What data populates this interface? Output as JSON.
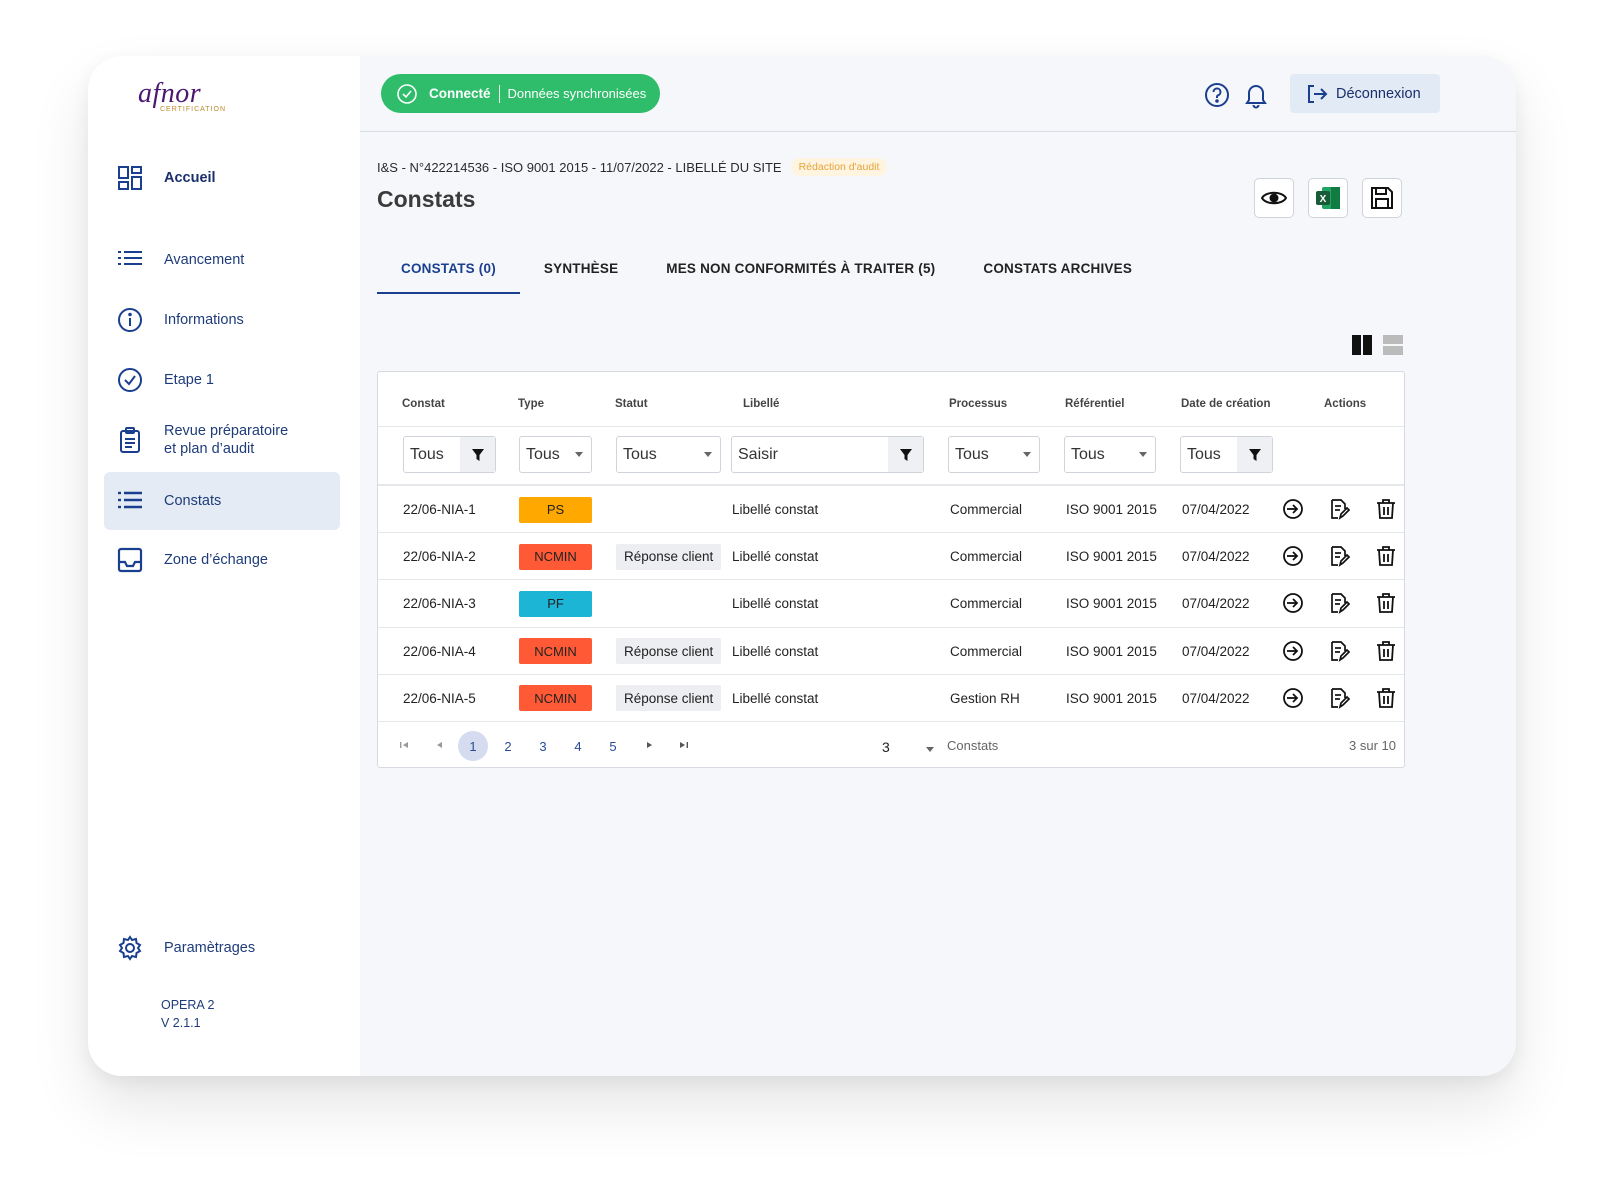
{
  "logo": {
    "word": "afnor",
    "sub": "CERTIFICATION"
  },
  "sidebar": {
    "items": [
      {
        "label": "Accueil",
        "icon": "dashboard-icon"
      },
      {
        "label": "Avancement",
        "icon": "list-icon"
      },
      {
        "label": "Informations",
        "icon": "info-icon"
      },
      {
        "label": "Etape 1",
        "icon": "check-circle-icon"
      },
      {
        "label": "Revue préparatoire\net plan d’audit",
        "icon": "clipboard-icon"
      },
      {
        "label": "Constats",
        "icon": "list-icon"
      },
      {
        "label": "Zone d’échange",
        "icon": "inbox-icon"
      },
      {
        "label": "Paramètrages",
        "icon": "gear-icon"
      }
    ],
    "version_line1": "OPERA 2",
    "version_line2": "V 2.1.1"
  },
  "topbar": {
    "status_connected": "Connecté",
    "status_synced": "Données synchronisées",
    "logout_label": "Déconnexion"
  },
  "header": {
    "breadcrumb": "I&S -  N°422214536 - ISO 9001 2015 - 11/07/2022 - LIBELLÉ DU SITE",
    "badge": "Rédaction d'audit",
    "title": "Constats"
  },
  "tabs": [
    "CONSTATS (0)",
    "SYNTHÈSE",
    "MES NON CONFORMITÉS À TRAITER (5)",
    "CONSTATS ARCHIVES"
  ],
  "table": {
    "columns": [
      "Constat",
      "Type",
      "Statut",
      "Libellé",
      "Processus",
      "Référentiel",
      "Date de création",
      "Actions"
    ],
    "filters": {
      "constat": "Tous",
      "type": "Tous",
      "statut": "Tous",
      "libelle_placeholder": "Saisir",
      "processus": "Tous",
      "referentiel": "Tous",
      "date": "Tous"
    },
    "rows": [
      {
        "constat": "22/06-NIA-1",
        "type": "PS",
        "type_color": "#ffa800",
        "statut": "",
        "libelle": "Libellé constat",
        "processus": "Commercial",
        "referentiel": "ISO 9001 2015",
        "date": "07/04/2022"
      },
      {
        "constat": "22/06-NIA-2",
        "type": "NCMIN",
        "type_color": "#ff5a35",
        "statut": "Réponse client",
        "libelle": "Libellé constat",
        "processus": "Commercial",
        "referentiel": "ISO 9001 2015",
        "date": "07/04/2022"
      },
      {
        "constat": "22/06-NIA-3",
        "type": "PF",
        "type_color": "#1cb5d6",
        "statut": "",
        "libelle": "Libellé constat",
        "processus": "Commercial",
        "referentiel": "ISO 9001 2015",
        "date": "07/04/2022"
      },
      {
        "constat": "22/06-NIA-4",
        "type": "NCMIN",
        "type_color": "#ff5a35",
        "statut": "Réponse client",
        "libelle": "Libellé constat",
        "processus": "Commercial",
        "referentiel": "ISO 9001 2015",
        "date": "07/04/2022"
      },
      {
        "constat": "22/06-NIA-5",
        "type": "NCMIN",
        "type_color": "#ff5a35",
        "statut": "Réponse client",
        "libelle": "Libellé constat",
        "processus": "Gestion RH",
        "referentiel": "ISO 9001 2015",
        "date": "07/04/2022"
      }
    ]
  },
  "pagination": {
    "pages": [
      "1",
      "2",
      "3",
      "4",
      "5"
    ],
    "current": "1",
    "per_page": "3",
    "per_page_label": "Constats",
    "count": "3 sur 10"
  },
  "colors": {
    "accent": "#1a3f8f",
    "connected_green": "#2fbd6b",
    "active_nav_bg": "#e4ebf5"
  }
}
